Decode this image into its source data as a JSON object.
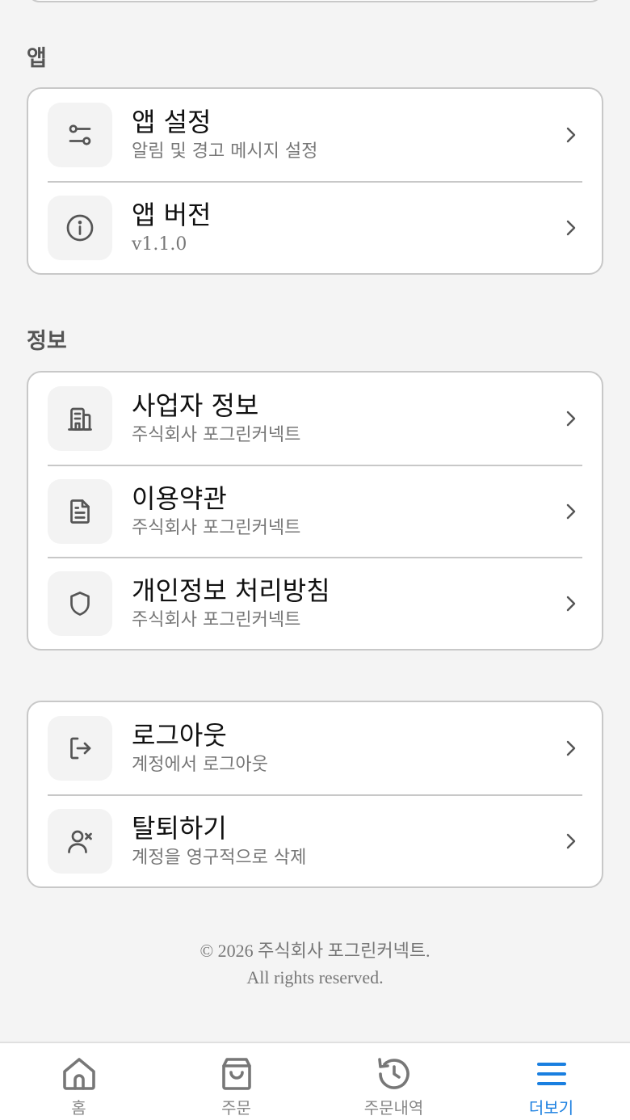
{
  "sections": {
    "app": {
      "title": "앱",
      "items": [
        {
          "title": "앱 설정",
          "subtitle": "알림 및 경고 메시지 설정",
          "icon": "sliders-icon"
        },
        {
          "title": "앱 버전",
          "subtitle": "v1.1.0",
          "icon": "info-icon"
        }
      ]
    },
    "info": {
      "title": "정보",
      "items": [
        {
          "title": "사업자 정보",
          "subtitle": "주식회사 포그린커넥트",
          "icon": "building-icon"
        },
        {
          "title": "이용약관",
          "subtitle": "주식회사 포그린커넥트",
          "icon": "document-icon"
        },
        {
          "title": "개인정보 처리방침",
          "subtitle": "주식회사 포그린커넥트",
          "icon": "shield-icon"
        }
      ]
    },
    "account": {
      "items": [
        {
          "title": "로그아웃",
          "subtitle": "계정에서 로그아웃",
          "icon": "logout-icon"
        },
        {
          "title": "탈퇴하기",
          "subtitle": "계정을 영구적으로 삭제",
          "icon": "user-remove-icon"
        }
      ]
    }
  },
  "footer": {
    "line1": "© 2026 주식회사 포그린커넥트.",
    "line2": "All rights reserved."
  },
  "bottom_nav": [
    {
      "label": "홈",
      "icon": "home-icon",
      "active": false
    },
    {
      "label": "주문",
      "icon": "shopping-bag-icon",
      "active": false
    },
    {
      "label": "주문내역",
      "icon": "history-icon",
      "active": false
    },
    {
      "label": "더보기",
      "icon": "menu-icon",
      "active": true
    }
  ],
  "colors": {
    "accent": "#1a7fe0",
    "icon_gray": "#555555",
    "background": "#f4f4f4"
  }
}
